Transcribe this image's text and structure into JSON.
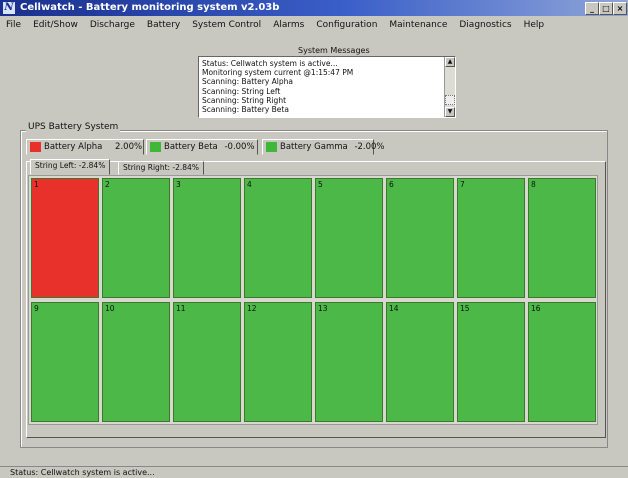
{
  "window": {
    "title": "Cellwatch - Battery monitoring system v2.03b",
    "controls": [
      "_",
      "□",
      "×"
    ]
  },
  "menu": [
    "File",
    "Edit/Show",
    "Discharge",
    "Battery",
    "System Control",
    "Alarms",
    "Configuration",
    "Maintenance",
    "Diagnostics",
    "Help"
  ],
  "system_messages": {
    "label": "System Messages",
    "lines": [
      "Status: Cellwatch system is active...",
      "Monitoring system current @1:15:47 PM",
      "Scanning: Battery Alpha",
      "Scanning: String Left",
      "Scanning: String Right",
      "Scanning: Battery Beta"
    ]
  },
  "group_label": "UPS Battery System",
  "battery_tabs": [
    {
      "label": "Battery Alpha",
      "value": "2.00%",
      "color": "#e8312a"
    },
    {
      "label": "Battery Beta",
      "value": "-0.00%",
      "color": "#3fb83a"
    },
    {
      "label": "Battery Gamma",
      "value": "-2.00%",
      "color": "#3fb83a"
    }
  ],
  "string_tabs": [
    {
      "label": "String Left: -2.84%",
      "active": true
    },
    {
      "label": "String Right: -2.84%",
      "active": false
    }
  ],
  "cells": [
    {
      "label": "1",
      "status_color": "#e8312a"
    },
    {
      "label": "2",
      "status_color": "#4cb847"
    },
    {
      "label": "3",
      "status_color": "#4cb847"
    },
    {
      "label": "4",
      "status_color": "#4cb847"
    },
    {
      "label": "5",
      "status_color": "#4cb847"
    },
    {
      "label": "6",
      "status_color": "#4cb847"
    },
    {
      "label": "7",
      "status_color": "#4cb847"
    },
    {
      "label": "8",
      "status_color": "#4cb847"
    },
    {
      "label": "9",
      "status_color": "#4cb847"
    },
    {
      "label": "10",
      "status_color": "#4cb847"
    },
    {
      "label": "11",
      "status_color": "#4cb847"
    },
    {
      "label": "12",
      "status_color": "#4cb847"
    },
    {
      "label": "13",
      "status_color": "#4cb847"
    },
    {
      "label": "14",
      "status_color": "#4cb847"
    },
    {
      "label": "15",
      "status_color": "#4cb847"
    },
    {
      "label": "16",
      "status_color": "#4cb847"
    }
  ],
  "status_bar": "Status: Cellwatch system is active..."
}
